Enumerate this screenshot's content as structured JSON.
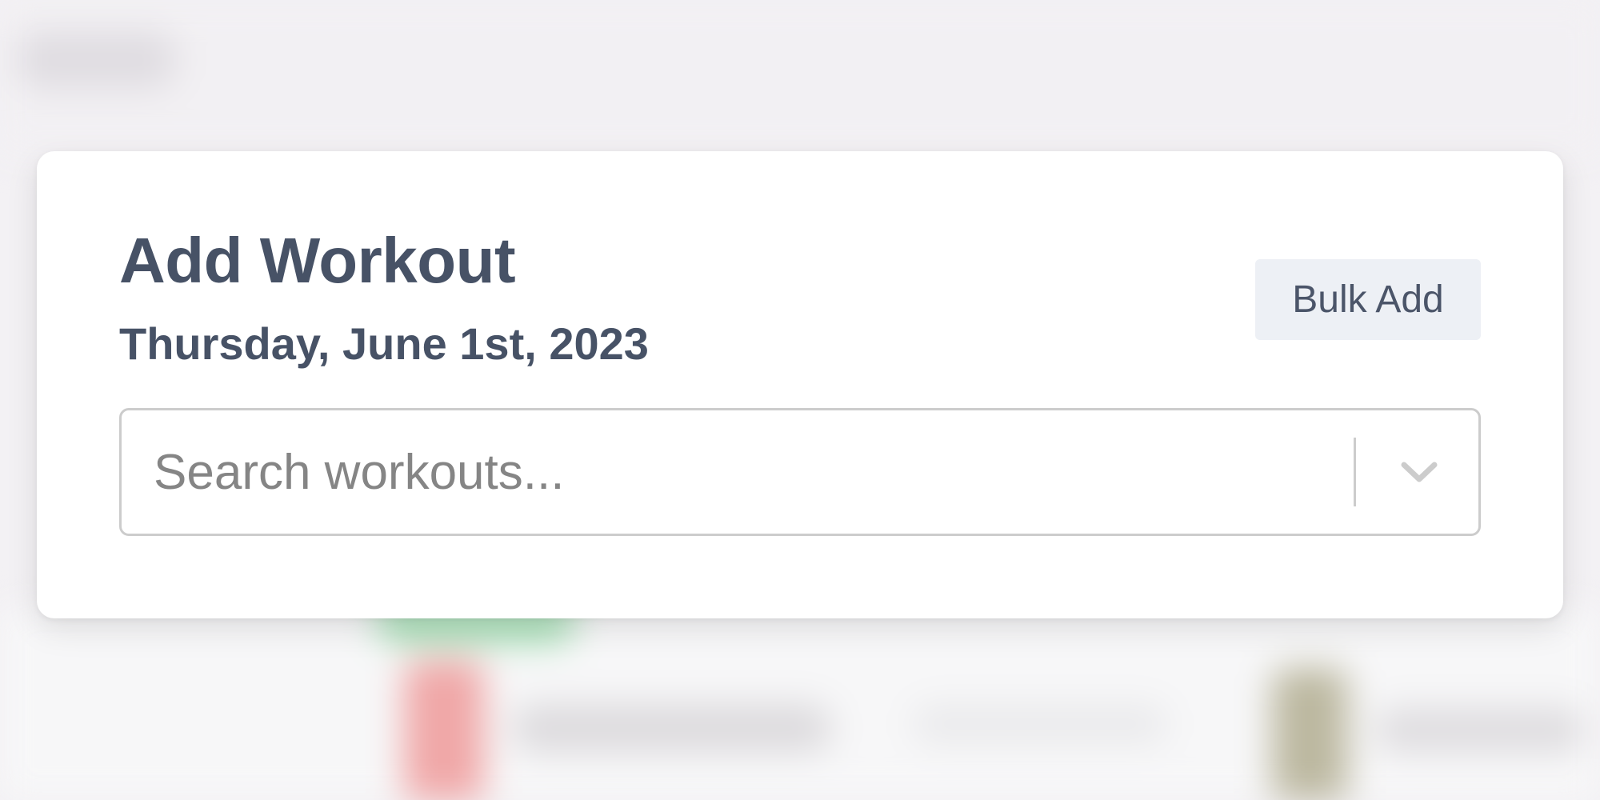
{
  "modal": {
    "title": "Add Workout",
    "date": "Thursday, June 1st, 2023",
    "bulk_add_label": "Bulk Add",
    "search": {
      "value": "",
      "placeholder": "Search workouts..."
    }
  },
  "icons": {
    "dropdown": "chevron-down-icon"
  },
  "colors": {
    "text": "#475266",
    "button_bg": "#edf0f5",
    "border": "#cccccc",
    "placeholder": "#858585",
    "background": "#f3f1f4"
  }
}
